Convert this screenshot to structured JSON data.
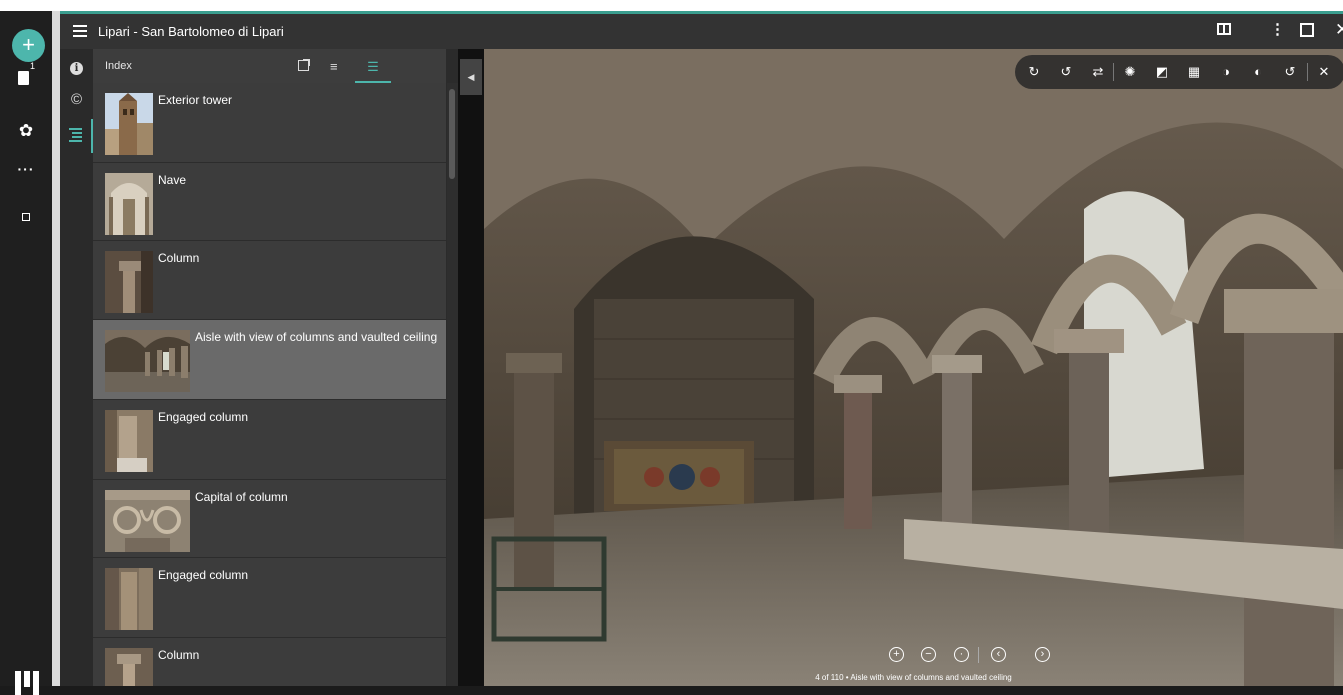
{
  "window": {
    "title": "Lipari - San Bartolomeo di Lipari"
  },
  "workspace": {
    "add_label": "+",
    "bookmark_badge": "1"
  },
  "panel": {
    "title": "Index",
    "items": [
      {
        "label": "Exterior tower",
        "thumb": "tower"
      },
      {
        "label": "Nave",
        "thumb": "nave"
      },
      {
        "label": "Column",
        "thumb": "column"
      },
      {
        "label": "Aisle with view of columns and vaulted ceiling",
        "thumb": "aisle"
      },
      {
        "label": "Engaged column",
        "thumb": "engaged"
      },
      {
        "label": "Capital of column",
        "thumb": "capital"
      },
      {
        "label": "Engaged column",
        "thumb": "engaged2"
      },
      {
        "label": "Column",
        "thumb": "column2"
      }
    ],
    "active_index": 3
  },
  "viewer": {
    "canvas_label": "4 of 110 • Aisle with view of columns and vaulted ceiling",
    "image_subject": "stone cloister aisle with columns and vaulted ceiling"
  },
  "icons": {
    "rotate_right": "rotate-right-icon",
    "rotate_left": "rotate-left-icon",
    "flip": "flip-icon",
    "brightness": "brightness-icon",
    "contrast": "contrast-icon",
    "grayscale": "grayscale-icon",
    "saturation": "saturation-icon",
    "invert": "invert-icon",
    "revert": "revert-icon"
  },
  "colors": {
    "accent": "#4db6ac",
    "active_row": "#6a6a6a"
  }
}
